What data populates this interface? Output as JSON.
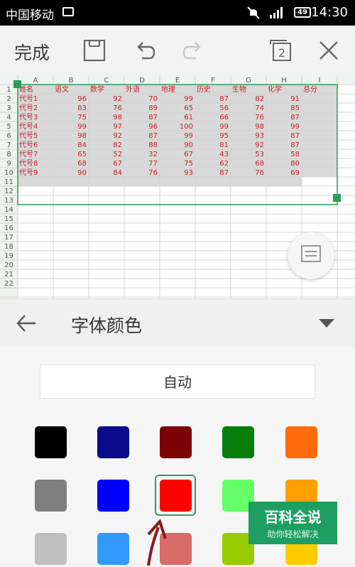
{
  "status_bar": {
    "carrier": "中国移动",
    "battery": "49",
    "time": "14:30"
  },
  "toolbar": {
    "done_label": "完成",
    "sheet_count": "2"
  },
  "sheet": {
    "columns": [
      "A",
      "B",
      "C",
      "D",
      "E",
      "F",
      "G",
      "H",
      "I"
    ],
    "row_numbers": [
      "1",
      "2",
      "3",
      "4",
      "5",
      "6",
      "7",
      "8",
      "9",
      "10",
      "11",
      "12",
      "13",
      "14",
      "15",
      "16",
      "17",
      "18",
      "19",
      "20",
      "21",
      "22"
    ],
    "headers": [
      "姓名",
      "语文",
      "数学",
      "外语",
      "地理",
      "历史",
      "生物",
      "化学",
      "总分"
    ],
    "rows": [
      [
        "代号1",
        "96",
        "92",
        "70",
        "99",
        "87",
        "82",
        "91"
      ],
      [
        "代号2",
        "83",
        "76",
        "89",
        "65",
        "56",
        "74",
        "85"
      ],
      [
        "代号3",
        "75",
        "98",
        "87",
        "61",
        "66",
        "76",
        "87"
      ],
      [
        "代号4",
        "99",
        "97",
        "96",
        "100",
        "99",
        "98",
        "99"
      ],
      [
        "代号5",
        "98",
        "92",
        "87",
        "99",
        "95",
        "93",
        "87"
      ],
      [
        "代号6",
        "84",
        "82",
        "88",
        "90",
        "81",
        "92",
        "87"
      ],
      [
        "代号7",
        "65",
        "52",
        "32",
        "67",
        "43",
        "53",
        "58"
      ],
      [
        "代号8",
        "68",
        "67",
        "77",
        "75",
        "62",
        "68",
        "80"
      ],
      [
        "代号9",
        "90",
        "84",
        "76",
        "93",
        "87",
        "76",
        "69"
      ]
    ],
    "text_color": "#c8202a",
    "selection_color": "#2e9b58"
  },
  "panel": {
    "title": "字体颜色",
    "auto_label": "自动",
    "swatch_colors": [
      [
        "#000000",
        "#0a0a8c",
        "#7c0208",
        "#067f0a",
        "#ff6a08"
      ],
      [
        "#808080",
        "#0000ff",
        "#ff0000",
        "#66ff66",
        "#ff9f00"
      ],
      [
        "#c0c0c0",
        "#3399ff",
        "#d86a6a",
        "#99cc00",
        "#ffcc00"
      ]
    ],
    "selected": "#ff0000"
  },
  "watermark": {
    "title": "百科全说",
    "subtitle": "助你轻松解决"
  }
}
